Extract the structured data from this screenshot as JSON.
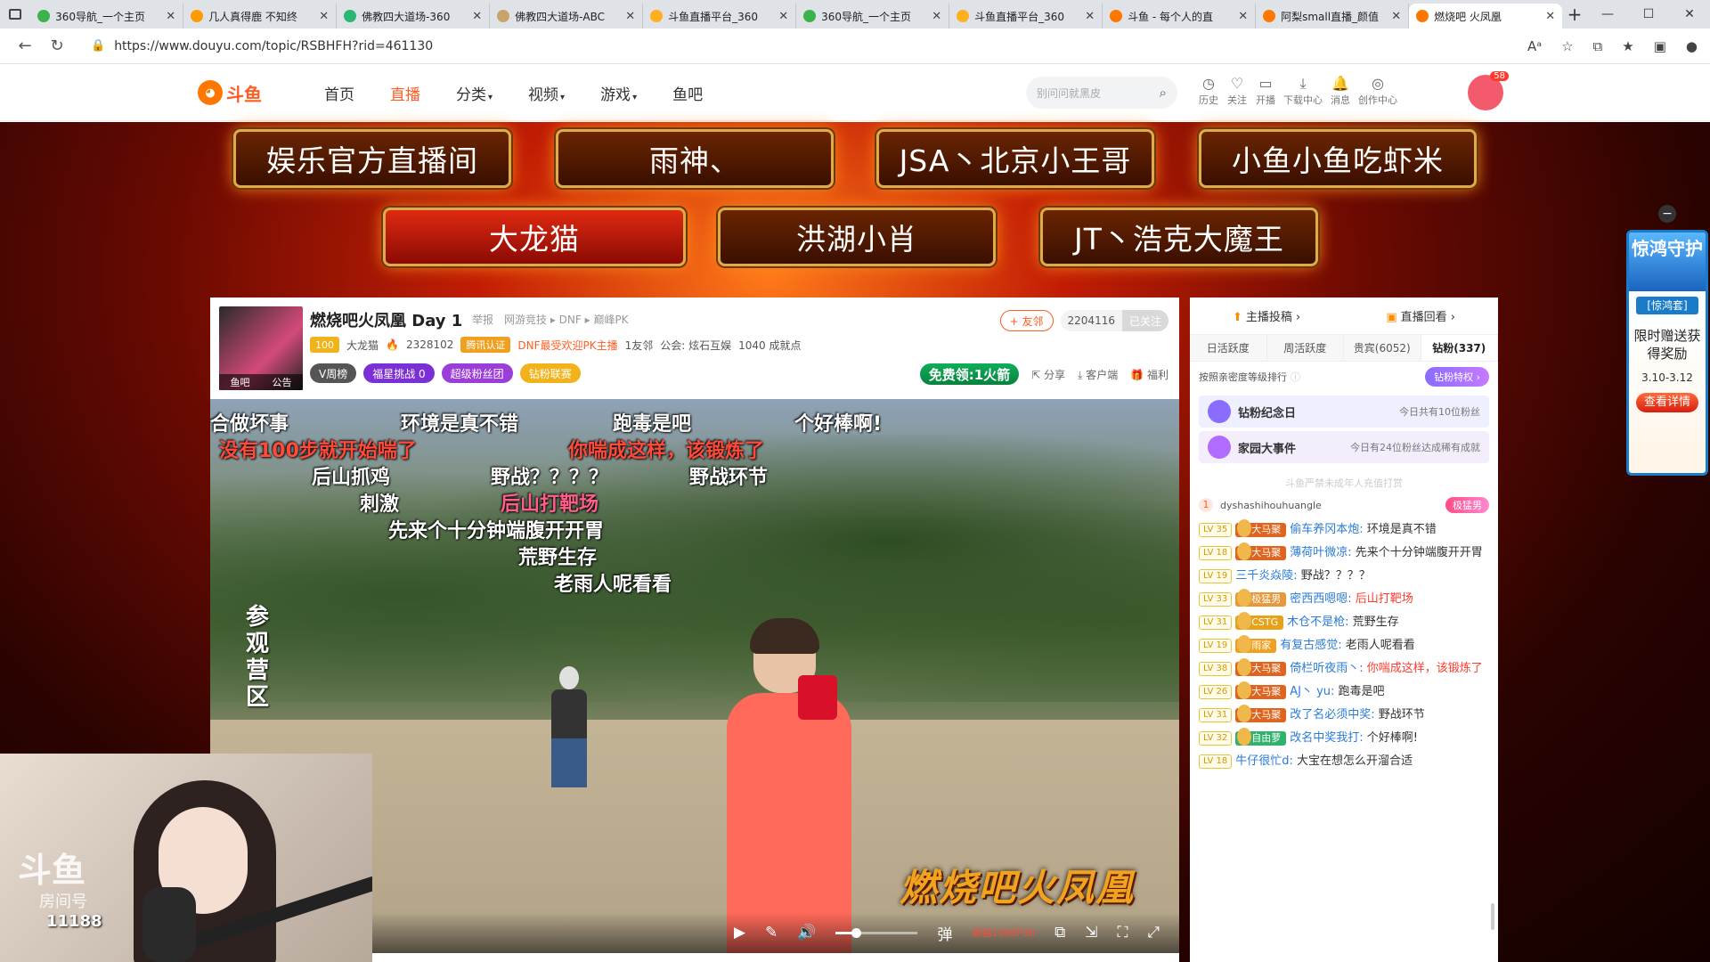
{
  "browser": {
    "tabs": [
      {
        "title": "360导航_一个主页",
        "color": "#3cb34a"
      },
      {
        "title": "几人真得鹿 不知终",
        "color": "#ff9a00"
      },
      {
        "title": "佛教四大道场-360",
        "color": "#2bb673"
      },
      {
        "title": "佛教四大道场-ABC",
        "color": "#c9a46a"
      },
      {
        "title": "斗鱼直播平台_360",
        "color": "#ffb020"
      },
      {
        "title": "360导航_一个主页",
        "color": "#3cb34a"
      },
      {
        "title": "斗鱼直播平台_360",
        "color": "#ffb020"
      },
      {
        "title": "斗鱼 - 每个人的直",
        "color": "#ff7700"
      },
      {
        "title": "阿梨small直播_颜值",
        "color": "#ff7700"
      },
      {
        "title": "燃烧吧 火凤凰",
        "color": "#ff7700"
      }
    ],
    "url": "https://www.douyu.com/topic/RSBHFH?rid=461130"
  },
  "header": {
    "logo_text": "斗鱼",
    "nav": [
      "首页",
      "直播",
      "分类",
      "视频",
      "游戏",
      "鱼吧"
    ],
    "search_placeholder": "别问问就黑皮",
    "tools": [
      {
        "icon": "history-icon",
        "glyph": "◷",
        "label": "历史"
      },
      {
        "icon": "heart-icon",
        "glyph": "♡",
        "label": "关注"
      },
      {
        "icon": "broadcast-icon",
        "glyph": "▭",
        "label": "开播"
      },
      {
        "icon": "download-icon",
        "glyph": "⤓",
        "label": "下载中心"
      },
      {
        "icon": "bell-icon",
        "glyph": "🔔",
        "label": "消息"
      },
      {
        "icon": "creator-icon",
        "glyph": "◎",
        "label": "创作中心"
      }
    ],
    "avatar_badge": "58"
  },
  "hero_plaques": [
    "娱乐官方直播间",
    "雨神、",
    "JSA丶北京小王哥",
    "小鱼小鱼吃虾米",
    "大龙猫",
    "洪湖小肖",
    "JT丶浩克大魔王"
  ],
  "room": {
    "title": "燃烧吧火凤凰 Day 1",
    "report": "举报",
    "category": "网游竞技 ▸ DNF ▸ 巅峰PK",
    "level": "100",
    "streamer": "大龙猫",
    "hot": "2328102",
    "cert": "腾讯认证",
    "tag": "DNF最受欢迎PK主播",
    "friends": "1友邻",
    "guild": "公会: 炫石互娱",
    "fans_done": "1040 成就点",
    "avatar_tags": [
      "鱼吧",
      "公告"
    ],
    "pills": [
      {
        "label": "V周榜",
        "bg": "#555"
      },
      {
        "label": "福星挑战  0",
        "bg": "#7b2fd6"
      },
      {
        "label": "超级粉丝团",
        "bg": "#9b3dd9"
      },
      {
        "label": "钻粉联赛",
        "bg": "#f2b21b"
      }
    ],
    "friend_btn": "+ 友邻",
    "follow_count": "2204116",
    "follow_state": "已关注",
    "rocket": "免费领:1火箭",
    "actions": [
      "分享",
      "客户端",
      "福利"
    ]
  },
  "danmaku": [
    {
      "text": "合做坏事",
      "cls": ""
    },
    {
      "text": "环境是真不错",
      "cls": ""
    },
    {
      "text": "跑毒是吧",
      "cls": ""
    },
    {
      "text": "个好棒啊!",
      "cls": ""
    },
    {
      "text": "没有100步就开始喘了",
      "cls": "red"
    },
    {
      "text": "你喘成这样，该锻炼了",
      "cls": "red"
    },
    {
      "text": "后山抓鸡",
      "cls": ""
    },
    {
      "text": "野战？？？？",
      "cls": ""
    },
    {
      "text": "野战环节",
      "cls": ""
    },
    {
      "text": "刺激",
      "cls": ""
    },
    {
      "text": "后山打靶场",
      "cls": "pink"
    },
    {
      "text": "先来个十分钟端腹开开胃",
      "cls": ""
    },
    {
      "text": "荒野生存",
      "cls": ""
    },
    {
      "text": "老雨人呢看看",
      "cls": ""
    }
  ],
  "video": {
    "sign_text": "参观营区",
    "watermark": "燃烧吧火凤凰",
    "quality": "原画1080P30",
    "volume_level": 0.25
  },
  "pip": {
    "brand": "斗鱼",
    "room_label": "房间号",
    "room_id": "11188"
  },
  "side": {
    "top_links": [
      "主播投稿 ›",
      "直播回看 ›"
    ],
    "rank_tabs": [
      "日活跃度",
      "周活跃度",
      "贵宾(6052)",
      "钻粉(337)"
    ],
    "rank_desc": "按照亲密度等级排行",
    "privilege": "钻粉特权 ›",
    "events": [
      {
        "title": "钻粉纪念日",
        "right": "今日共有10位粉丝",
        "bg": "#eef0ff",
        "icon": "#8a6cff"
      },
      {
        "title": "家园大事件",
        "right": "今日有24位粉丝达成稀有成就",
        "bg": "#f4eefc",
        "icon": "#b06cff"
      }
    ],
    "notice": "斗鱼严禁未成年人充值打赏",
    "top_user": {
      "rank": "1",
      "name": "dyshashihouhuangle",
      "badge": "极猛男"
    },
    "messages": [
      {
        "lv": "LV 35",
        "badge": "大马聚",
        "bcol": "#e0641f",
        "user": "偷车养冈本炮:",
        "text": "环境是真不错",
        "red": false
      },
      {
        "lv": "LV 18",
        "badge": "大马聚",
        "bcol": "#e0641f",
        "user": "薄荷叶微凉:",
        "text": "先来个十分钟端腹开开胃",
        "red": false
      },
      {
        "lv": "LV 19",
        "badge": "",
        "bcol": "",
        "user": "三千炎焱陵:",
        "text": "野战？？？？",
        "red": false
      },
      {
        "lv": "LV 33",
        "badge": "极猛男",
        "bcol": "#e8973a",
        "user": "密西西嗯嗯:",
        "text": "后山打靶场",
        "red": true
      },
      {
        "lv": "LV 31",
        "badge": "CSTG",
        "bcol": "#e8a21a",
        "user": "木仓不是枪:",
        "text": "荒野生存",
        "red": false
      },
      {
        "lv": "LV 19",
        "badge": "雨家",
        "bcol": "#f0a020",
        "user": "有复古感觉:",
        "text": "老雨人呢看看",
        "red": false
      },
      {
        "lv": "LV 38",
        "badge": "大马聚",
        "bcol": "#e0641f",
        "user": "倚栏听夜雨丶:",
        "text": "你喘成这样，该锻炼了",
        "red": true
      },
      {
        "lv": "LV 26",
        "badge": "大马聚",
        "bcol": "#e0641f",
        "user": "AJ丶 yu:",
        "text": "跑毒是吧",
        "red": false
      },
      {
        "lv": "LV 31",
        "badge": "大马聚",
        "bcol": "#e0641f",
        "user": "改了名必须中奖:",
        "text": "野战环节",
        "red": false
      },
      {
        "lv": "LV 32",
        "badge": "自由萝",
        "bcol": "#2db36a",
        "user": "改名中奖我打:",
        "text": "个好棒啊!",
        "red": false
      },
      {
        "lv": "LV 18",
        "badge": "",
        "bcol": "",
        "user": "牛仔很忙d:",
        "text": "大宝在想怎么开溜合适",
        "red": false
      }
    ]
  },
  "float_ad": {
    "title": "惊鸿守护",
    "tag": "[惊鸿套]",
    "body": "限时赠送获得奖励",
    "date": "3.10-3.12",
    "button": "查看详情",
    "close": "−"
  }
}
